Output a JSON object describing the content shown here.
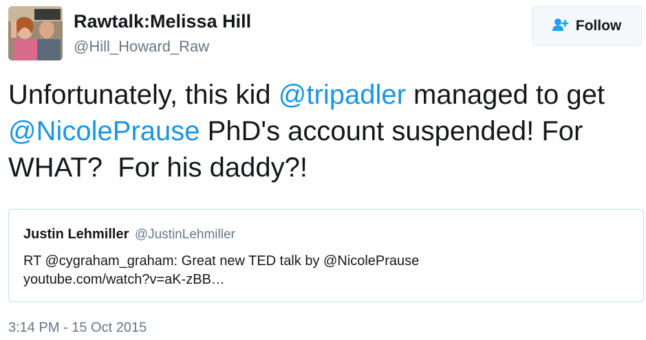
{
  "author": {
    "display_name": "Rawtalk:Melissa Hill",
    "handle": "@Hill_Howard_Raw"
  },
  "follow_button": {
    "label": "Follow",
    "icon": "add-user-icon"
  },
  "tweet": {
    "segments": [
      {
        "text": "Unfortunately, this kid ",
        "type": "text"
      },
      {
        "text": "@tripadler",
        "type": "mention"
      },
      {
        "text": " managed to get ",
        "type": "text"
      },
      {
        "text": "@NicolePrause",
        "type": "mention"
      },
      {
        "text": " PhD's account suspended! For WHAT?  For his daddy?!",
        "type": "text"
      }
    ]
  },
  "quote": {
    "name": "Justin Lehmiller",
    "handle": "@JustinLehmiller",
    "line1": "RT @cygraham_graham: Great new TED talk by @NicolePrause",
    "line2": "youtube.com/watch?v=aK-zBB…"
  },
  "timestamp": "3:14 PM - 15 Oct 2015",
  "colors": {
    "link": "#1b95e0",
    "secondary_text": "#657786",
    "quote_border": "#bcdff1",
    "follow_icon": "#1da1f2"
  }
}
